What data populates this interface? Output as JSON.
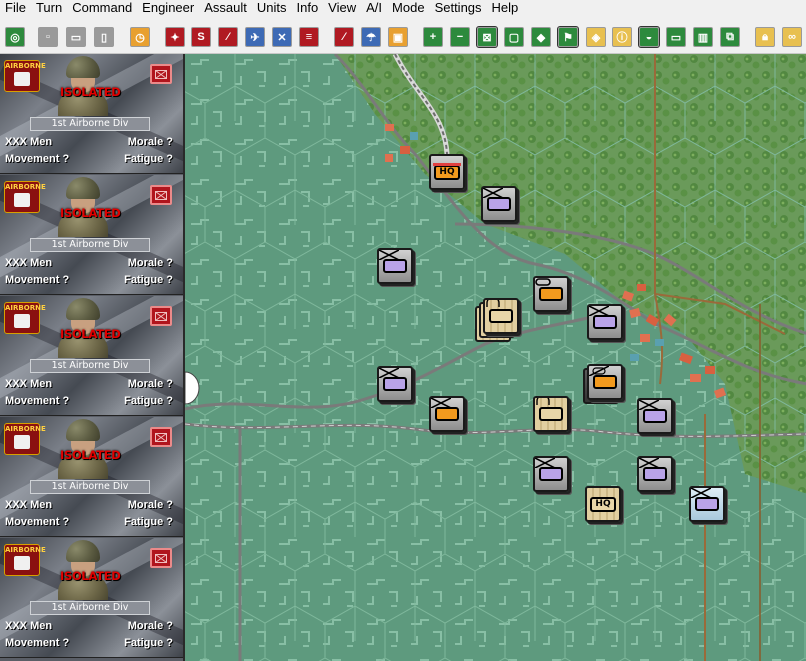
{
  "menu": [
    "File",
    "Turn",
    "Command",
    "Engineer",
    "Assault",
    "Units",
    "Info",
    "View",
    "A/I",
    "Mode",
    "Settings",
    "Help"
  ],
  "toolbar_icons": [
    {
      "name": "target-icon",
      "bg": "#2d8a3d"
    },
    {
      "name": "blank-doc-icon",
      "bg": "#9a9a9a"
    },
    {
      "name": "open-folder-icon",
      "bg": "#9a9a9a"
    },
    {
      "name": "page-icon",
      "bg": "#9a9a9a"
    },
    {
      "name": "clock-icon",
      "bg": "#e8a030"
    },
    {
      "name": "attack-icon",
      "bg": "#b01a22"
    },
    {
      "name": "strength-icon",
      "bg": "#b01a22"
    },
    {
      "name": "fire-icon",
      "bg": "#b01a22"
    },
    {
      "name": "plane-icon",
      "bg": "#3d6ab5"
    },
    {
      "name": "air-strike-icon",
      "bg": "#3d6ab5"
    },
    {
      "name": "list-icon",
      "bg": "#b01a22"
    },
    {
      "name": "rail-icon",
      "bg": "#b01a22"
    },
    {
      "name": "parachute-icon",
      "bg": "#3d6ab5"
    },
    {
      "name": "supply-icon",
      "bg": "#e8a030"
    },
    {
      "name": "zoom-in-icon",
      "bg": "#2d8a3d"
    },
    {
      "name": "zoom-out-icon",
      "bg": "#2d8a3d"
    },
    {
      "name": "hex-grid-icon",
      "bg": "#2d8a3d"
    },
    {
      "name": "fit-icon",
      "bg": "#2d8a3d"
    },
    {
      "name": "diamond-icon",
      "bg": "#2d8a3d"
    },
    {
      "name": "flag-icon",
      "bg": "#2d8a3d"
    },
    {
      "name": "eye-icon",
      "bg": "#e8c050"
    },
    {
      "name": "info-icon",
      "bg": "#e8c050"
    },
    {
      "name": "terrain-icon",
      "bg": "#2d8a3d"
    },
    {
      "name": "monitor-icon",
      "bg": "#2d8a3d"
    },
    {
      "name": "map-icon",
      "bg": "#2d8a3d"
    },
    {
      "name": "windows-icon",
      "bg": "#2d8a3d"
    },
    {
      "name": "lock-icon",
      "bg": "#e8c050"
    },
    {
      "name": "binoculars-icon",
      "bg": "#e8c050"
    }
  ],
  "units": [
    {
      "patch": "AIRBORNE",
      "status": "ISOLATED",
      "division": "1st Airborne Div",
      "men": "XXX Men",
      "morale": "Morale ?",
      "movement": "Movement ?",
      "fatigue": "Fatigue ?"
    },
    {
      "patch": "AIRBORNE",
      "status": "ISOLATED",
      "division": "1st Airborne Div",
      "men": "XXX Men",
      "morale": "Morale ?",
      "movement": "Movement ?",
      "fatigue": "Fatigue ?"
    },
    {
      "patch": "AIRBORNE",
      "status": "ISOLATED",
      "division": "1st Airborne Div",
      "men": "XXX Men",
      "morale": "Morale ?",
      "movement": "Movement ?",
      "fatigue": "Fatigue ?"
    },
    {
      "patch": "AIRBORNE",
      "status": "ISOLATED",
      "division": "1st Airborne Div",
      "men": "XXX Men",
      "morale": "Morale ?",
      "movement": "Movement ?",
      "fatigue": "Fatigue ?"
    },
    {
      "patch": "AIRBORNE",
      "status": "ISOLATED",
      "division": "1st Airborne Div",
      "men": "XXX Men",
      "morale": "Morale ?",
      "movement": "Movement ?",
      "fatigue": "Fatigue ?"
    }
  ],
  "map_counters": {
    "hq_label_1": "HQ",
    "hq_label_2": "HQ"
  },
  "colors": {
    "isolated_text": "#e00000",
    "counter_purple": "#b9a3e8",
    "counter_orange": "#f29a1e",
    "polder_green": "#5e9a7e",
    "forest_green": "#6a9a5a"
  }
}
